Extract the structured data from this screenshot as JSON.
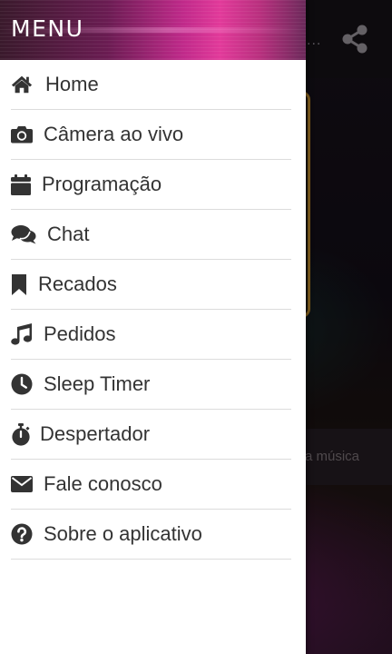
{
  "drawer": {
    "title": "MENU",
    "items": [
      {
        "label": "Home",
        "icon": "home-icon"
      },
      {
        "label": "Câmera ao vivo",
        "icon": "camera-icon"
      },
      {
        "label": "Programação",
        "icon": "calendar-icon"
      },
      {
        "label": "Chat",
        "icon": "chat-icon"
      },
      {
        "label": "Recados",
        "icon": "bookmark-icon"
      },
      {
        "label": "Pedidos",
        "icon": "music-note-icon"
      },
      {
        "label": "Sleep Timer",
        "icon": "clock-icon"
      },
      {
        "label": "Despertador",
        "icon": "stopwatch-icon"
      },
      {
        "label": "Fale conosco",
        "icon": "envelope-icon"
      },
      {
        "label": "Sobre o aplicativo",
        "icon": "question-circle-icon"
      }
    ]
  },
  "background": {
    "title_fragment": "...",
    "search_fragment": "a música",
    "share_icon": "share-icon"
  },
  "colors": {
    "icon": "#333333",
    "text": "#333333",
    "divider": "#dcdcdc",
    "header_accent": "#e23a9a",
    "player_border": "#c8922e"
  }
}
